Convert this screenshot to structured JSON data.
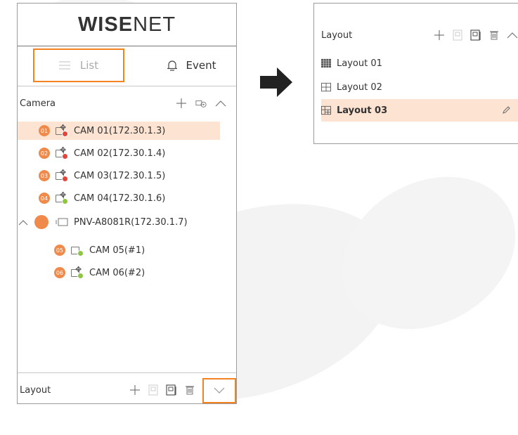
{
  "logo": {
    "brand_bold": "WISE",
    "brand_thin": "NET"
  },
  "tabs": {
    "list_label": "List",
    "event_label": "Event"
  },
  "camera": {
    "title": "Camera",
    "items": [
      {
        "badge": "01",
        "label": "CAM 01(172.30.1.3)",
        "status_color": "#e0463c"
      },
      {
        "badge": "02",
        "label": "CAM 02(172.30.1.4)",
        "status_color": "#e0463c"
      },
      {
        "badge": "03",
        "label": "CAM 03(172.30.1.5)",
        "status_color": "#e0463c"
      },
      {
        "badge": "04",
        "label": "CAM 04(172.30.1.6)",
        "status_color": "#8dc63f"
      }
    ],
    "group": {
      "label": "PNV-A8081R(172.30.1.7)",
      "children": [
        {
          "badge": "05",
          "label": "CAM 05(#1)",
          "status_color": "#8dc63f"
        },
        {
          "badge": "06",
          "label": "CAM 06(#2)",
          "status_color": "#8dc63f"
        }
      ]
    }
  },
  "layout_bottom": {
    "title": "Layout"
  },
  "layout_panel": {
    "title": "Layout",
    "items": [
      {
        "label": "Layout 01",
        "icon": "grid-4x4-icon"
      },
      {
        "label": "Layout 02",
        "icon": "grid-2x2-icon"
      },
      {
        "label": "Layout 03",
        "icon": "grid-custom-icon",
        "selected": true
      }
    ]
  },
  "colors": {
    "accent": "#f58220",
    "badge": "#f08a4b",
    "selected_row": "#fde3d2",
    "status_red": "#e0463c",
    "status_green": "#8dc63f"
  }
}
